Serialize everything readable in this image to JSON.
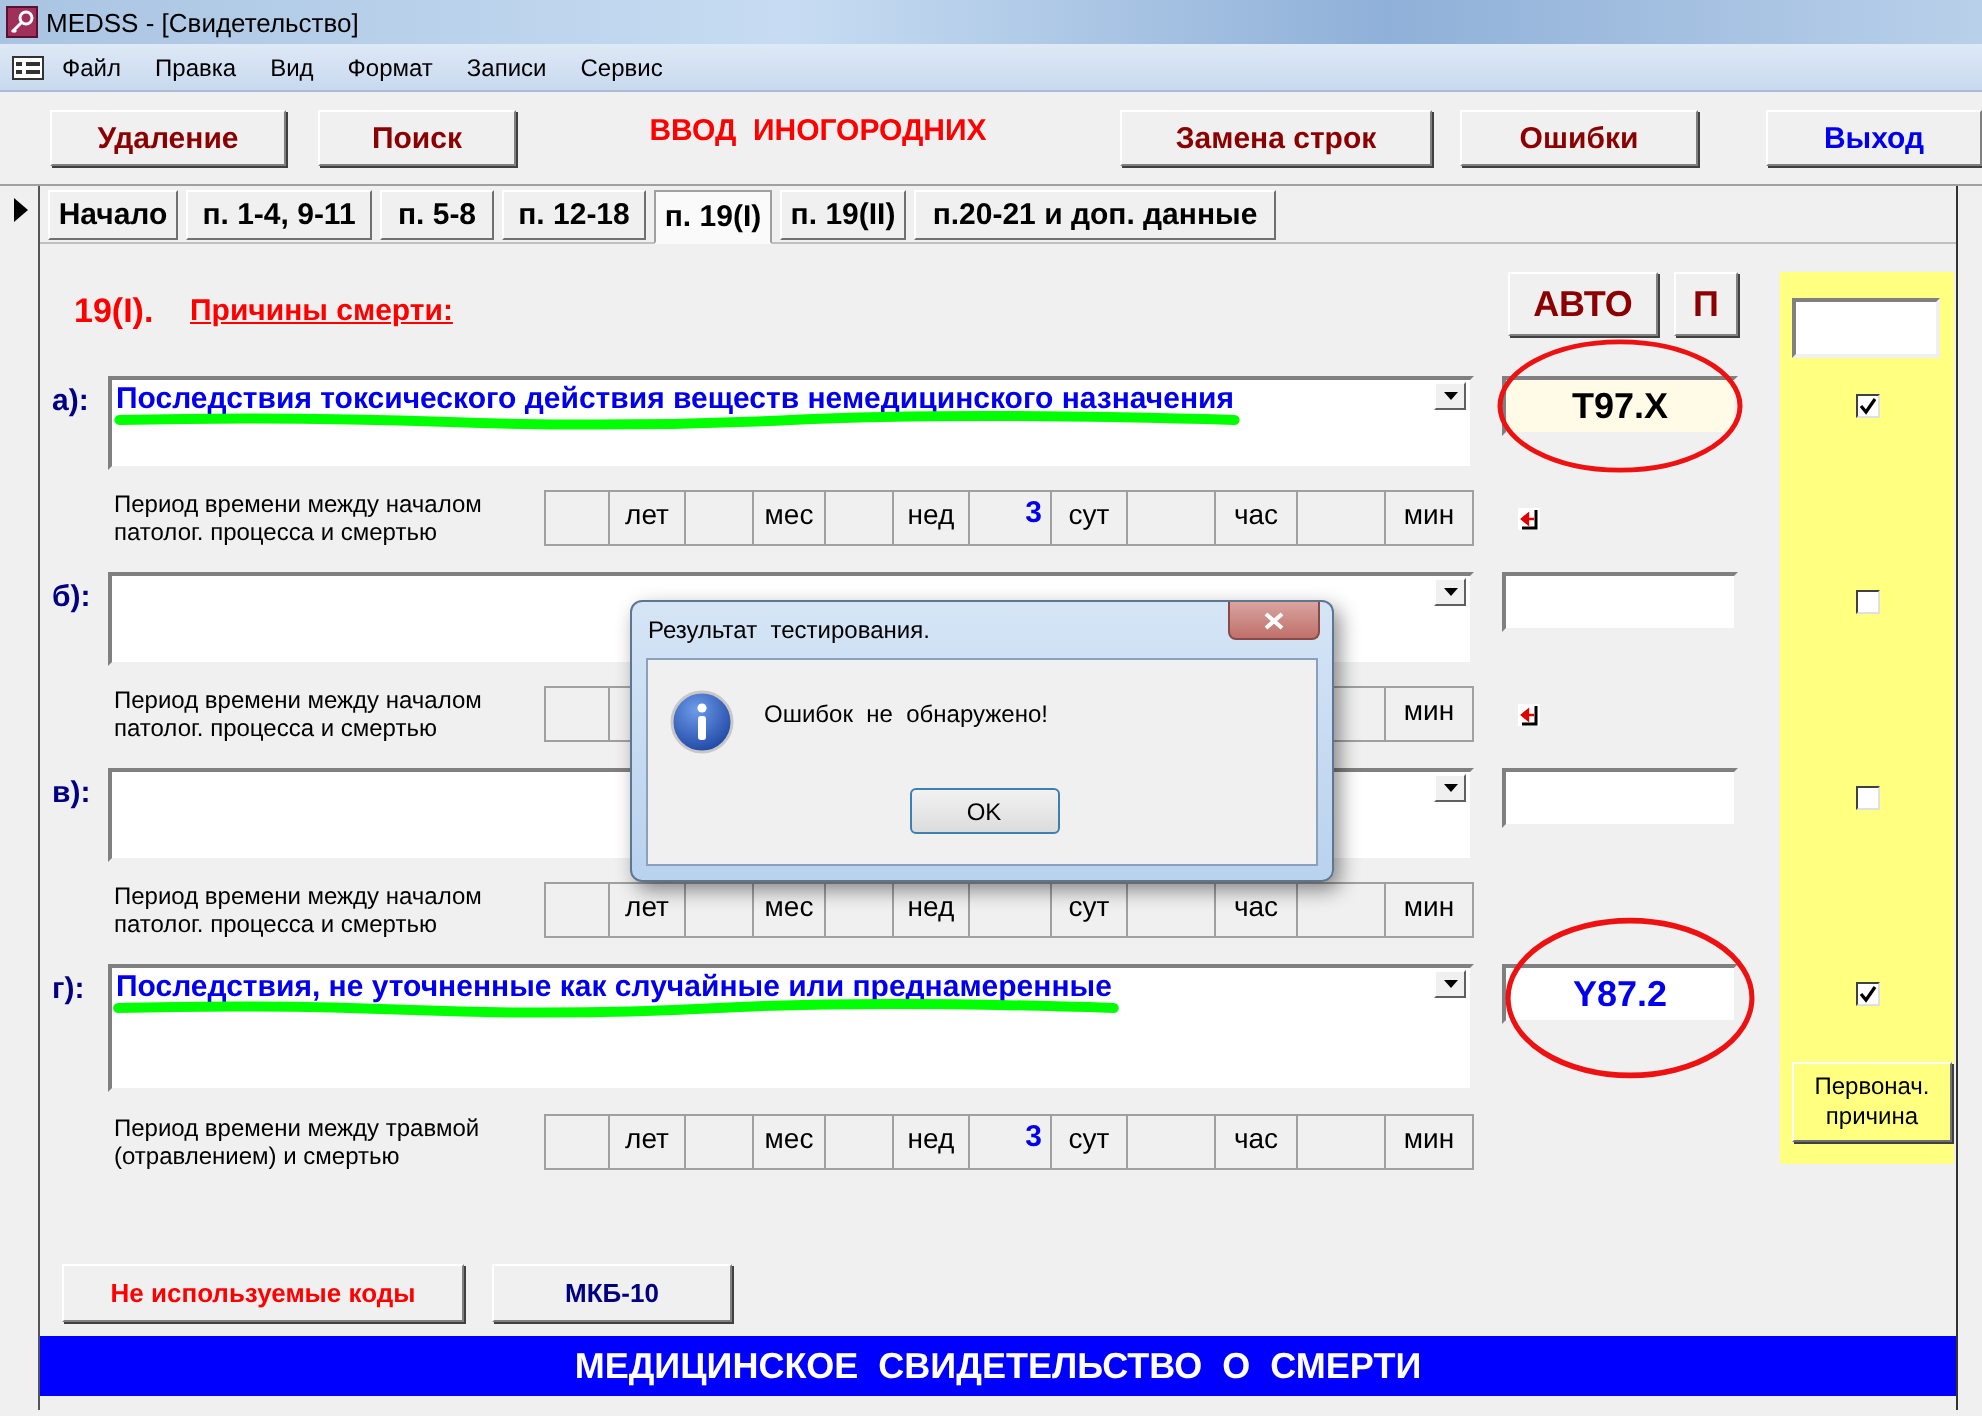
{
  "window": {
    "title": "MEDSS - [Свидетельство]"
  },
  "menu": [
    "Файл",
    "Правка",
    "Вид",
    "Формат",
    "Записи",
    "Сервис"
  ],
  "toolbar": {
    "left": [
      {
        "label": "Удаление",
        "kind": "action"
      },
      {
        "label": "Поиск",
        "kind": "action"
      }
    ],
    "title": "ВВОД  ИНОГОРОДНИХ",
    "right": [
      {
        "label": "Замена строк",
        "kind": "action"
      },
      {
        "label": "Ошибки",
        "kind": "action"
      },
      {
        "label": "Выход",
        "kind": "exit"
      }
    ]
  },
  "tabs": [
    {
      "label": "Начало",
      "selected": false
    },
    {
      "label": "п. 1-4, 9-11",
      "selected": false
    },
    {
      "label": "п. 5-8",
      "selected": false
    },
    {
      "label": "п. 12-18",
      "selected": false
    },
    {
      "label": "п. 19(I)",
      "selected": true
    },
    {
      "label": "п. 19(II)",
      "selected": false
    },
    {
      "label": "п.20-21 и доп. данные",
      "selected": false
    }
  ],
  "section": {
    "number": "19(I).",
    "title": "Причины смерти:"
  },
  "auto_buttons": [
    "АВТО",
    "П"
  ],
  "rows": [
    {
      "letter": "а):",
      "cause": "Последствия токсического действия веществ немедицинского назначения",
      "highlighted": true,
      "code": "T97.X",
      "code_highlighted": true,
      "circled": true,
      "period_label": "Период времени между началом патолог. процесса и смертью",
      "period": [
        {
          "unit": "лет"
        },
        {
          "unit": "мес"
        },
        {
          "unit": "нед"
        },
        {
          "value": "3",
          "unit": "сут"
        },
        {
          "unit": "час"
        },
        {
          "unit": "мин"
        }
      ],
      "jump_icon": true,
      "checked": true
    },
    {
      "letter": "б):",
      "highlighted": false,
      "circled": false,
      "period_label": "Период времени между началом патолог. процесса и смертью",
      "period": [
        {
          "unit": "мин"
        }
      ],
      "jump_icon": true,
      "checked": false
    },
    {
      "letter": "в):",
      "highlighted": false,
      "circled": false,
      "period_label": "Период времени между началом патолог. процесса и смертью",
      "period": [
        {
          "unit": "лет"
        },
        {
          "unit": "мес"
        },
        {
          "unit": "нед"
        },
        {
          "unit": "сут"
        },
        {
          "unit": "час"
        },
        {
          "unit": "мин"
        }
      ],
      "jump_icon": false,
      "checked": false
    },
    {
      "letter": "г):",
      "cause": "Последствия,  не уточненные как случайные или преднамеренные",
      "highlighted": true,
      "code": "Y87.2",
      "code_highlighted": false,
      "circled": true,
      "period_label": "Период времени между травмой (отравлением) и смертью",
      "period": [
        {
          "unit": "лет"
        },
        {
          "unit": "мес"
        },
        {
          "unit": "нед"
        },
        {
          "value": "3",
          "unit": "сут"
        },
        {
          "unit": "час"
        },
        {
          "unit": "мин"
        }
      ],
      "jump_icon": false,
      "checked": true
    }
  ],
  "primary_cause_button": "Первонач. причина",
  "bottom_buttons": [
    {
      "label": "Не используемые коды",
      "kind": "warning"
    },
    {
      "label": "МКБ-10",
      "kind": "normal"
    }
  ],
  "banner": "МЕДИЦИНСКОЕ  СВИДЕТЕЛЬСТВО  О  СМЕРТИ",
  "dialog": {
    "title": "Результат  тестирования.",
    "message": "Ошибок  не  обнаружено!",
    "button": "OK"
  }
}
